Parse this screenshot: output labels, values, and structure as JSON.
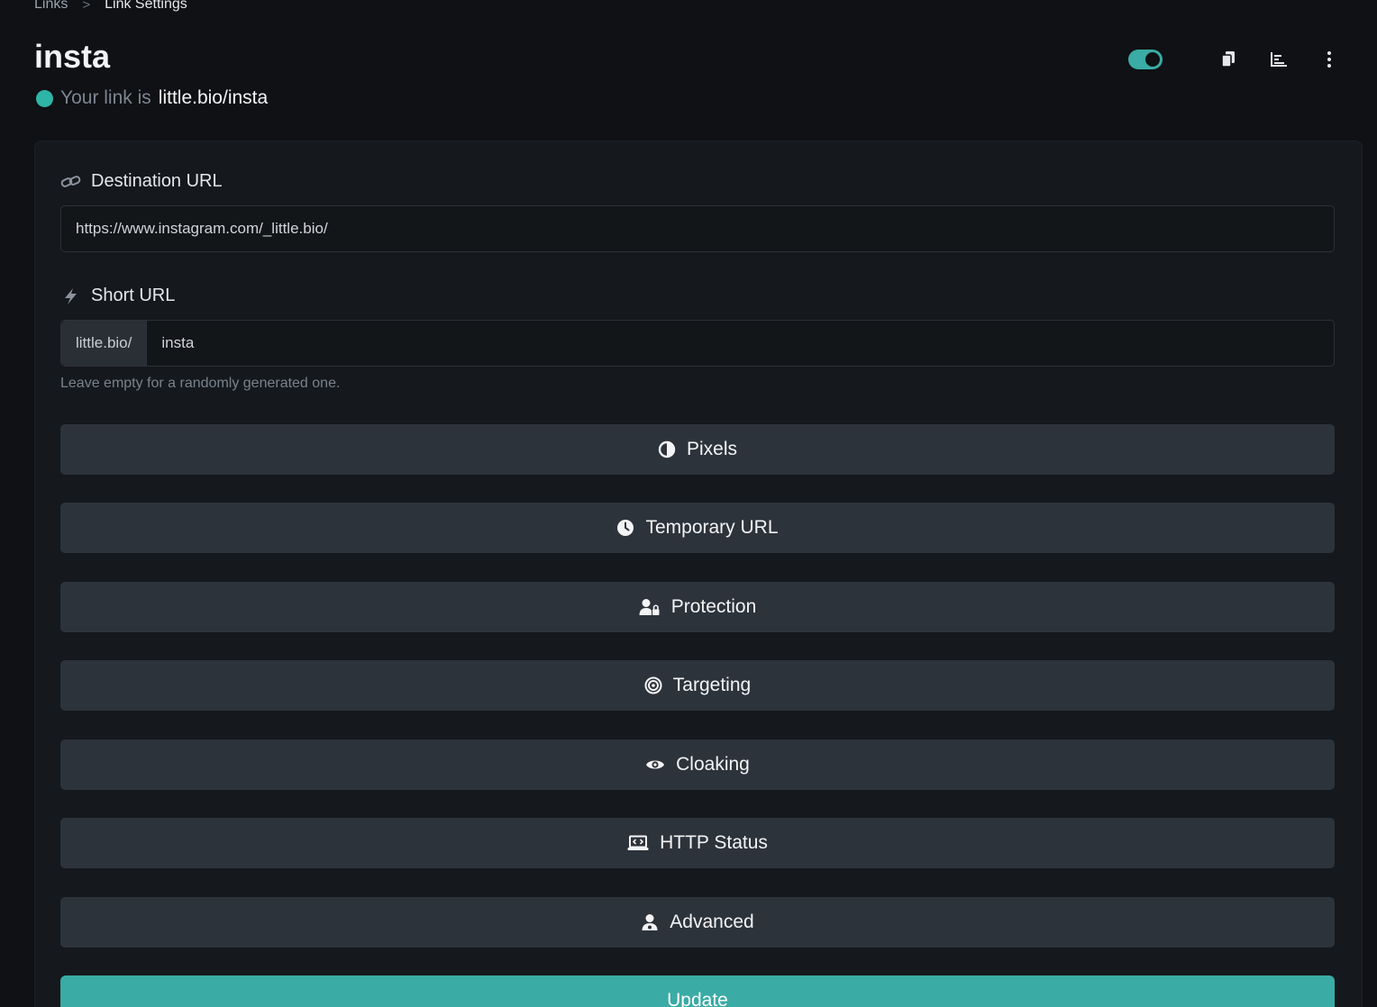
{
  "breadcrumb": {
    "items": [
      "Links",
      "Link Settings"
    ],
    "separator": ">"
  },
  "header": {
    "title": "insta",
    "link_prefix": "Your link is",
    "link_value": "little.bio/insta",
    "status_color": "#2fb5a7",
    "toggle_on": true,
    "icons": [
      "toggle-switch",
      "copy-icon",
      "stats-icon",
      "more-vertical-icon"
    ]
  },
  "destination": {
    "label": "Destination URL",
    "icon": "link-icon",
    "value": "https://www.instagram.com/_little.bio/"
  },
  "short_url": {
    "label": "Short URL",
    "icon": "bolt-icon",
    "prefix": "little.bio/",
    "value": "insta",
    "help": "Leave empty for a randomly generated one."
  },
  "sections": [
    {
      "label": "Pixels",
      "icon": "half-circle-icon"
    },
    {
      "label": "Temporary URL",
      "icon": "clock-icon"
    },
    {
      "label": "Protection",
      "icon": "user-lock-icon"
    },
    {
      "label": "Targeting",
      "icon": "target-icon"
    },
    {
      "label": "Cloaking",
      "icon": "eye-icon"
    },
    {
      "label": "HTTP Status",
      "icon": "laptop-code-icon"
    },
    {
      "label": "Advanced",
      "icon": "user-gear-icon"
    }
  ],
  "update_button": {
    "label": "Update"
  },
  "accent_color": "#3aaba5"
}
